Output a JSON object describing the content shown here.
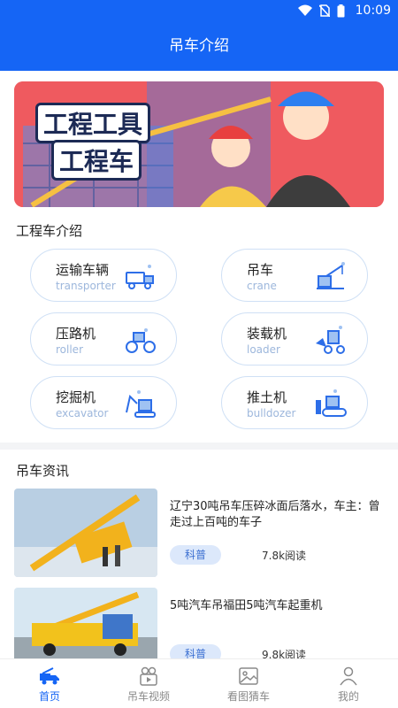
{
  "status": {
    "time": "10:09"
  },
  "header": {
    "title": "吊车介绍"
  },
  "banner": {
    "line1": "工程工具",
    "line2": "工程车"
  },
  "intro": {
    "title": "工程车介绍",
    "items": [
      {
        "zh": "运输车辆",
        "en": "transporter",
        "icon": "transporter-icon"
      },
      {
        "zh": "吊车",
        "en": "crane",
        "icon": "crane-icon"
      },
      {
        "zh": "压路机",
        "en": "roller",
        "icon": "roller-icon"
      },
      {
        "zh": "装载机",
        "en": "loader",
        "icon": "loader-icon"
      },
      {
        "zh": "挖掘机",
        "en": "excavator",
        "icon": "excavator-icon"
      },
      {
        "zh": "推土机",
        "en": "bulldozer",
        "icon": "bulldozer-icon"
      }
    ]
  },
  "news": {
    "title": "吊车资讯",
    "items": [
      {
        "title": "辽宁30吨吊车压碎冰面后落水，车主：曾走过上百吨的车子",
        "tag": "科普",
        "reads": "7.8k阅读"
      },
      {
        "title": "5吨汽车吊福田5吨汽车起重机",
        "tag": "科普",
        "reads": "9.8k阅读"
      }
    ]
  },
  "tabs": [
    {
      "label": "首页",
      "icon": "truck-icon"
    },
    {
      "label": "吊车视频",
      "icon": "video-icon"
    },
    {
      "label": "看图猜车",
      "icon": "image-icon"
    },
    {
      "label": "我的",
      "icon": "user-icon"
    }
  ],
  "colors": {
    "primary": "#1565f5",
    "tag_bg": "#dce8fb",
    "banner_bg": "#ef5a5f"
  }
}
